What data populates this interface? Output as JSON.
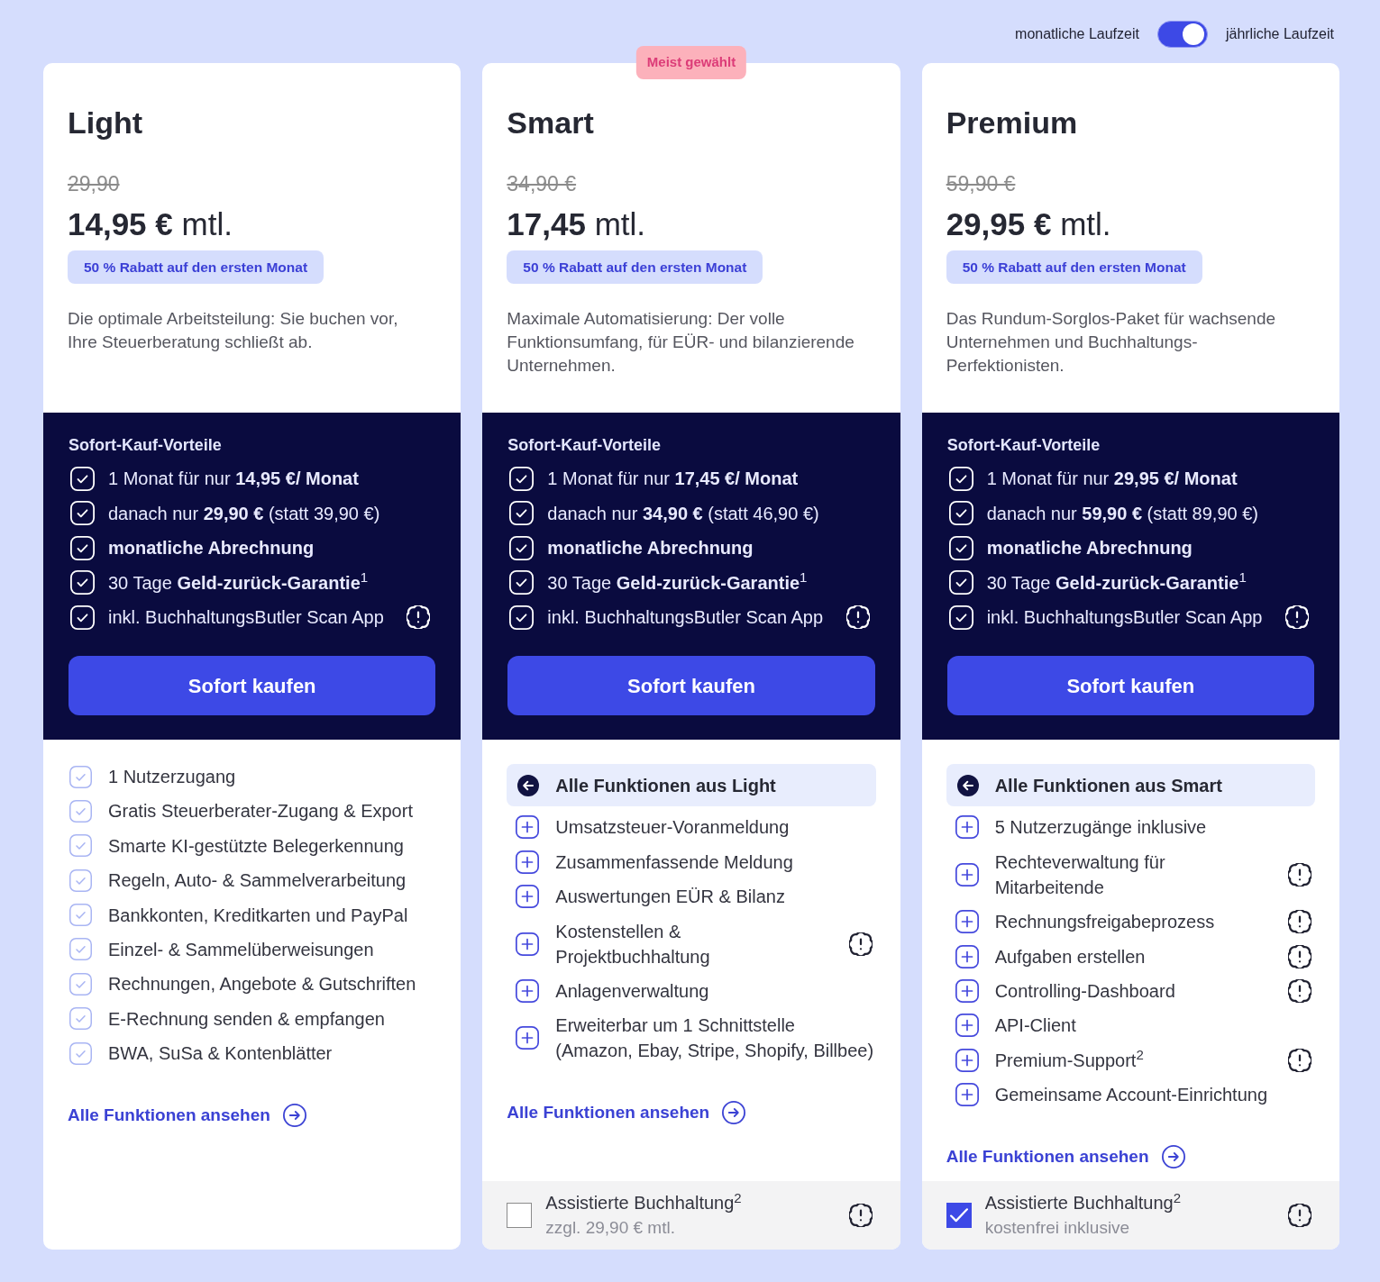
{
  "billing_toggle": {
    "left_label": "monatliche Laufzeit",
    "on": true,
    "right_label": "jährliche Laufzeit"
  },
  "plans": [
    {
      "name": "Light",
      "old_price": "29,90",
      "price": "**14,95 €** mtl.",
      "discount": "50 % Rabatt auf den ersten Monat",
      "description": "Die optimale Arbeitsteilung: Sie buchen vor, Ihre Steuerberatung schließt ab.",
      "benefits": {
        "title": "Sofort-Kauf-Vorteile",
        "items": [
          {
            "text": "1 Monat für nur **14,95 €/ Monat**",
            "info": false
          },
          {
            "text": "danach nur **29,90 €** (statt 39,90 €)",
            "info": false
          },
          {
            "text": "**monatliche Abrechnung**",
            "info": false
          },
          {
            "text": "30 Tage **Geld-zurück-Garantie**$^{1}$",
            "info": false
          },
          {
            "text": "inkl. BuchhaltungsButler Scan App",
            "info": true
          }
        ]
      },
      "buy_button": "Sofort kaufen",
      "features": [
        {
          "kind": "check",
          "text": "1 Nutzerzugang",
          "info": false
        },
        {
          "kind": "check",
          "text": "Gratis Steuerberater-Zugang & Export",
          "info": false
        },
        {
          "kind": "check",
          "text": "Smarte KI-gestützte Belegerkennung",
          "info": false
        },
        {
          "kind": "check",
          "text": "Regeln, Auto- & Sammelverarbeitung",
          "info": false
        },
        {
          "kind": "check",
          "text": "Bankkonten, Kreditkarten und PayPal",
          "info": false
        },
        {
          "kind": "check",
          "text": "Einzel- & Sammelüberweisungen",
          "info": false
        },
        {
          "kind": "check",
          "text": "Rechnungen, Angebote & Gutschriften",
          "info": false
        },
        {
          "kind": "check",
          "text": "E-Rechnung senden & empfangen",
          "info": false
        },
        {
          "kind": "check",
          "text": "BWA, SuSa & Kontenblätter",
          "info": false
        }
      ],
      "features_link": "Alle Funktionen ansehen"
    },
    {
      "name": "Smart",
      "badge": "Meist gewählt",
      "old_price": "34,90 €",
      "price": "**17,45** mtl.",
      "discount": "50 % Rabatt auf den ersten Monat",
      "description": "Maximale Automatisierung: Der volle Funktionsumfang, für EÜR- und bilanzierende Unternehmen.",
      "benefits": {
        "title": "Sofort-Kauf-Vorteile",
        "items": [
          {
            "text": "1 Monat für nur **17,45 €/ Monat**",
            "info": false
          },
          {
            "text": "danach nur **34,90 €** (statt 46,90 €)",
            "info": false
          },
          {
            "text": "**monatliche Abrechnung**",
            "info": false
          },
          {
            "text": "30 Tage **Geld-zurück-Garantie**$^{1}$",
            "info": false
          },
          {
            "text": "inkl. BuchhaltungsButler Scan App",
            "info": true
          }
        ]
      },
      "buy_button": "Sofort kaufen",
      "features": [
        {
          "kind": "included",
          "text": "Alle Funktionen aus Light",
          "info": false
        },
        {
          "kind": "plus",
          "text": "Umsatzsteuer-Voranmeldung",
          "info": false
        },
        {
          "kind": "plus",
          "text": "Zusammenfassende Meldung",
          "info": false
        },
        {
          "kind": "plus",
          "text": "Auswertungen EÜR & Bilanz",
          "info": false
        },
        {
          "kind": "plus",
          "text": "Kostenstellen & Projektbuchhaltung",
          "info": true
        },
        {
          "kind": "plus",
          "text": "Anlagenverwaltung",
          "info": false
        },
        {
          "kind": "plus",
          "text": "Erweiterbar um 1 Schnittstelle (Amazon, Ebay, Stripe, Shopify, Billbee)",
          "info": false
        }
      ],
      "features_link": "Alle Funktionen ansehen",
      "addon": {
        "label": "Assistierte Buchhaltung$^{2}$",
        "note": "zzgl. 29,90 € mtl.",
        "checked": false,
        "info": true
      }
    },
    {
      "name": "Premium",
      "old_price": "59,90 €",
      "price": "**29,95 €** mtl.",
      "discount": "50 % Rabatt auf den ersten Monat",
      "description": "Das Rundum-Sorglos-Paket für wachsende Unternehmen und Buchhaltungs-Perfektionisten.",
      "benefits": {
        "title": "Sofort-Kauf-Vorteile",
        "items": [
          {
            "text": "1 Monat für nur **29,95 €/ Monat**",
            "info": false
          },
          {
            "text": "danach nur **59,90 €** (statt 89,90 €)",
            "info": false
          },
          {
            "text": "**monatliche Abrechnung**",
            "info": false
          },
          {
            "text": "30 Tage **Geld-zurück-Garantie**$^{1}$",
            "info": false
          },
          {
            "text": "inkl. BuchhaltungsButler Scan App",
            "info": true
          }
        ]
      },
      "buy_button": "Sofort kaufen",
      "features": [
        {
          "kind": "included",
          "text": "Alle Funktionen aus Smart",
          "info": false
        },
        {
          "kind": "plus",
          "text": "5 Nutzerzugänge inklusive",
          "info": false
        },
        {
          "kind": "plus",
          "text": "Rechteverwaltung für Mitarbeitende",
          "info": true
        },
        {
          "kind": "plus",
          "text": "Rechnungsfreigabeprozess",
          "info": true
        },
        {
          "kind": "plus",
          "text": "Aufgaben erstellen",
          "info": true
        },
        {
          "kind": "plus",
          "text": "Controlling-Dashboard",
          "info": true
        },
        {
          "kind": "plus",
          "text": "API-Client",
          "info": false
        },
        {
          "kind": "plus",
          "text": "Premium-Support$^{2}$",
          "info": true
        },
        {
          "kind": "plus",
          "text": "Gemeinsame Account-Einrichtung",
          "info": false
        }
      ],
      "features_link": "Alle Funktionen ansehen",
      "addon": {
        "label": "Assistierte Buchhaltung$^{2}$",
        "note": "kostenfrei inklusive",
        "checked": true,
        "info": true
      }
    }
  ]
}
